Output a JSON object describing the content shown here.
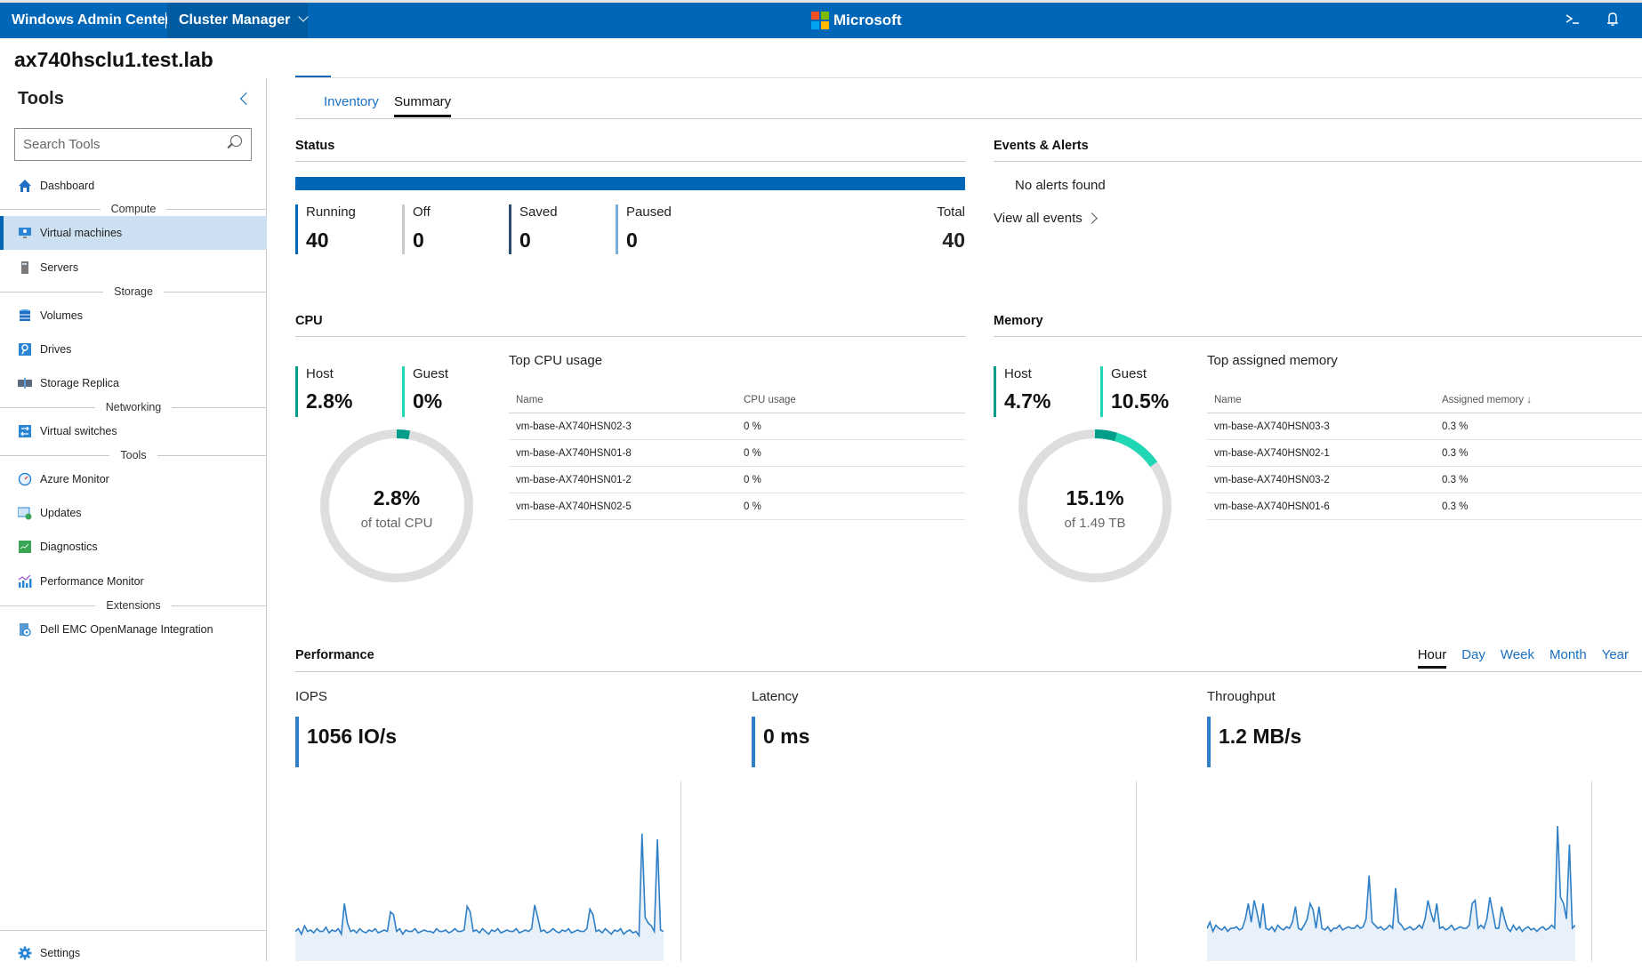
{
  "header": {
    "app_name": "Windows Admin Center",
    "context_menu": "Cluster Manager",
    "brand": "Microsoft",
    "icons": [
      "powershell-icon",
      "notifications-bell-icon"
    ],
    "brand_color": "#0067b8"
  },
  "page_title": "ax740hsclu1.test.lab",
  "sidebar": {
    "title": "Tools",
    "search_placeholder": "Search Tools",
    "items": [
      {
        "label": "Dashboard",
        "icon": "home-icon"
      },
      {
        "group": "Compute"
      },
      {
        "label": "Virtual machines",
        "icon": "virtual-machine-icon",
        "active": true
      },
      {
        "label": "Servers",
        "icon": "server-icon"
      },
      {
        "group": "Storage"
      },
      {
        "label": "Volumes",
        "icon": "volumes-icon"
      },
      {
        "label": "Drives",
        "icon": "drive-icon"
      },
      {
        "label": "Storage Replica",
        "icon": "storage-replica-icon"
      },
      {
        "group": "Networking"
      },
      {
        "label": "Virtual switches",
        "icon": "virtual-switch-icon"
      },
      {
        "group": "Tools"
      },
      {
        "label": "Azure Monitor",
        "icon": "azure-monitor-icon"
      },
      {
        "label": "Updates",
        "icon": "updates-icon"
      },
      {
        "label": "Diagnostics",
        "icon": "diagnostics-icon"
      },
      {
        "label": "Performance Monitor",
        "icon": "performance-monitor-icon"
      },
      {
        "group": "Extensions"
      },
      {
        "label": "Dell EMC OpenManage Integration",
        "icon": "openmanage-icon"
      }
    ],
    "settings_label": "Settings"
  },
  "tabs": [
    {
      "label": "Inventory",
      "active": false
    },
    {
      "label": "Summary",
      "active": true
    }
  ],
  "status": {
    "title": "Status",
    "running_fraction": 1.0,
    "items": [
      {
        "label": "Running",
        "value": "40",
        "color": "#0067b8"
      },
      {
        "label": "Off",
        "value": "0",
        "color": "#c8c8c8"
      },
      {
        "label": "Saved",
        "value": "0",
        "color": "#2b4a73"
      },
      {
        "label": "Paused",
        "value": "0",
        "color": "#7aaedc"
      }
    ],
    "total_label": "Total",
    "total_value": "40"
  },
  "events": {
    "title": "Events & Alerts",
    "message": "No alerts found",
    "link_label": "View all events"
  },
  "cpu": {
    "title": "CPU",
    "host_label": "Host",
    "host_value": "2.8%",
    "guest_label": "Guest",
    "guest_value": "0%",
    "donut_value": "2.8%",
    "donut_caption": "of total CPU",
    "host_pct": 2.8,
    "guest_pct": 0,
    "table_title": "Top CPU usage",
    "columns": [
      "Name",
      "CPU usage"
    ],
    "rows": [
      [
        "vm-base-AX740HSN02-3",
        "0 %"
      ],
      [
        "vm-base-AX740HSN01-8",
        "0 %"
      ],
      [
        "vm-base-AX740HSN01-2",
        "0 %"
      ],
      [
        "vm-base-AX740HSN02-5",
        "0 %"
      ]
    ]
  },
  "memory": {
    "title": "Memory",
    "host_label": "Host",
    "host_value": "4.7%",
    "guest_label": "Guest",
    "guest_value": "10.5%",
    "donut_value": "15.1%",
    "donut_caption": "of 1.49 TB",
    "host_pct": 4.7,
    "guest_pct": 10.5,
    "table_title": "Top assigned memory",
    "columns": [
      "Name",
      "Assigned memory ↓"
    ],
    "rows": [
      [
        "vm-base-AX740HSN03-3",
        "0.3 %"
      ],
      [
        "vm-base-AX740HSN02-1",
        "0.3 %"
      ],
      [
        "vm-base-AX740HSN03-2",
        "0.3 %"
      ],
      [
        "vm-base-AX740HSN01-6",
        "0.3 %"
      ]
    ]
  },
  "colors": {
    "host": "#009e8a",
    "guest": "#20d6b5",
    "track": "#dedede",
    "line": "#2f7fc6",
    "area": "#e8f1fa"
  },
  "performance": {
    "title": "Performance",
    "ranges": [
      {
        "label": "Hour",
        "active": true
      },
      {
        "label": "Day"
      },
      {
        "label": "Week"
      },
      {
        "label": "Month"
      },
      {
        "label": "Year"
      }
    ],
    "metrics": [
      {
        "label": "IOPS",
        "value": "1056 IO/s"
      },
      {
        "label": "Latency",
        "value": "0 ms"
      },
      {
        "label": "Throughput",
        "value": "1.2 MB/s"
      }
    ]
  },
  "chart_data": [
    {
      "type": "area",
      "title": "IOPS",
      "xlabel": "",
      "ylabel": "",
      "grid": false,
      "ylim": [
        0,
        5
      ],
      "values": [
        1.0,
        1.1,
        0.9,
        1.2,
        1.0,
        1.05,
        0.95,
        1.1,
        1.0,
        1.0,
        1.15,
        0.95,
        1.05,
        1.0,
        1.1,
        0.9,
        2.0,
        1.3,
        1.0,
        1.05,
        0.95,
        1.1,
        1.0,
        0.95,
        1.05,
        1.0,
        1.1,
        0.95,
        1.0,
        1.05,
        1.0,
        1.7,
        1.6,
        1.0,
        1.1,
        0.9,
        1.05,
        1.0,
        1.0,
        1.1,
        0.95,
        1.0,
        1.05,
        1.0,
        1.0,
        0.95,
        1.1,
        1.0,
        1.0,
        1.05,
        0.95,
        1.0,
        1.1,
        1.0,
        1.0,
        1.05,
        1.9,
        1.7,
        1.0,
        1.05,
        0.95,
        1.1,
        1.0,
        0.9,
        1.05,
        1.0,
        1.1,
        0.95,
        1.0,
        1.05,
        1.0,
        1.0,
        1.1,
        0.95,
        1.0,
        1.05,
        1.0,
        1.1,
        1.95,
        1.5,
        1.0,
        1.05,
        0.95,
        1.0,
        1.1,
        1.0,
        0.95,
        1.05,
        1.0,
        1.1,
        0.95,
        1.0,
        1.05,
        1.0,
        1.0,
        1.1,
        1.8,
        1.6,
        1.0,
        1.05,
        0.95,
        1.1,
        1.0,
        0.9,
        1.05,
        1.0,
        1.1,
        0.9,
        1.0,
        1.05,
        0.95,
        1.0,
        0.85,
        4.5,
        1.5,
        1.3,
        1.2,
        1.0,
        4.3,
        1.05,
        1.0
      ]
    },
    {
      "type": "area",
      "title": "Latency",
      "xlabel": "",
      "ylabel": "",
      "grid": false,
      "values": []
    },
    {
      "type": "area",
      "title": "Throughput",
      "xlabel": "",
      "ylabel": "",
      "grid": false,
      "ylim": [
        0,
        4.5
      ],
      "values": [
        1.0,
        1.2,
        0.9,
        1.1,
        1.0,
        0.95,
        1.05,
        0.9,
        1.0,
        1.0,
        1.05,
        0.95,
        1.0,
        1.3,
        1.8,
        1.2,
        1.9,
        1.5,
        1.0,
        1.8,
        1.0,
        0.95,
        1.05,
        0.9,
        1.1,
        1.0,
        0.95,
        1.05,
        1.0,
        1.2,
        1.7,
        1.0,
        0.95,
        1.1,
        1.3,
        1.8,
        1.6,
        1.0,
        1.7,
        1.0,
        0.95,
        1.05,
        0.9,
        1.0,
        1.0,
        1.1,
        0.95,
        1.0,
        1.05,
        1.0,
        1.0,
        1.1,
        1.0,
        1.05,
        1.3,
        2.7,
        1.2,
        1.1,
        1.0,
        1.05,
        0.95,
        1.0,
        1.1,
        1.0,
        2.3,
        1.2,
        1.1,
        0.95,
        1.0,
        1.05,
        0.95,
        1.0,
        1.1,
        1.0,
        1.3,
        1.9,
        1.5,
        1.2,
        1.8,
        1.0,
        1.05,
        0.95,
        1.0,
        1.1,
        0.95,
        1.0,
        1.05,
        1.0,
        1.0,
        1.1,
        1.8,
        1.9,
        1.0,
        1.1,
        1.0,
        1.3,
        2.0,
        1.5,
        1.0,
        1.0,
        1.7,
        1.3,
        1.0,
        0.9,
        1.1,
        0.95,
        1.05,
        0.9,
        1.0,
        1.05,
        0.95,
        1.0,
        0.9,
        1.0,
        1.05,
        0.95,
        1.0,
        1.1,
        1.0,
        4.3,
        2.0,
        1.8,
        1.3,
        3.7,
        1.0,
        1.1
      ]
    }
  ]
}
